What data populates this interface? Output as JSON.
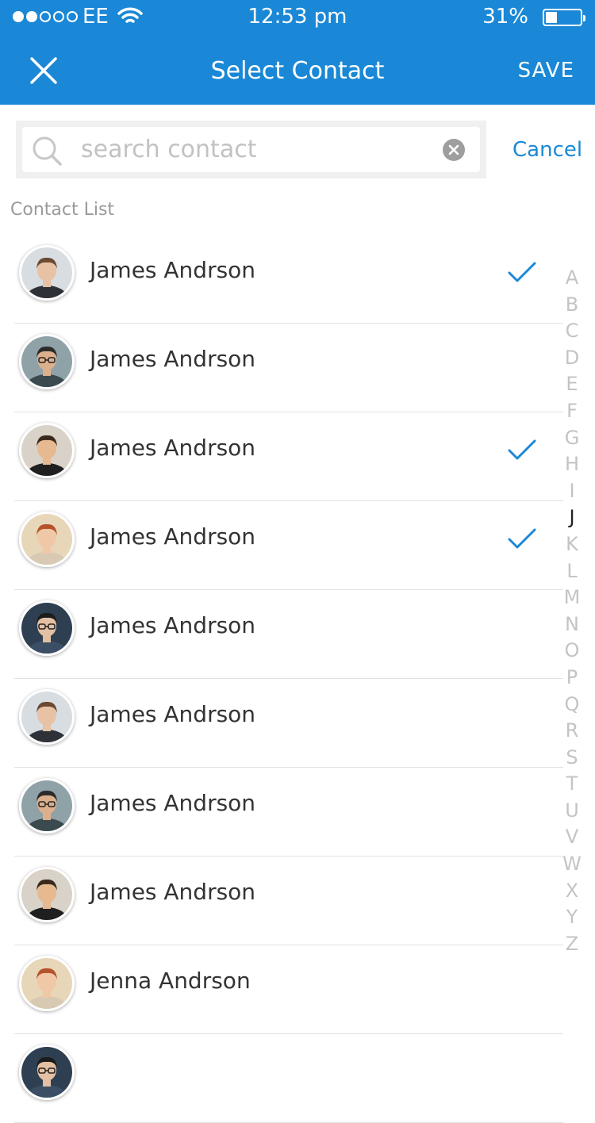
{
  "status_bar": {
    "carrier": "EE",
    "time": "12:53 pm",
    "battery": "31%",
    "battery_level": 0.31
  },
  "nav": {
    "title": "Select Contact",
    "save_label": "SAVE",
    "close_icon": "close-icon"
  },
  "search": {
    "placeholder": "search contact",
    "value": "",
    "cancel_label": "Cancel"
  },
  "section_label": "Contact List",
  "contacts": [
    {
      "name": "James Andrson",
      "selected": true
    },
    {
      "name": "James Andrson",
      "selected": false
    },
    {
      "name": "James Andrson",
      "selected": true
    },
    {
      "name": "James Andrson",
      "selected": true
    },
    {
      "name": "James Andrson",
      "selected": false
    },
    {
      "name": "James Andrson",
      "selected": false
    },
    {
      "name": "James Andrson",
      "selected": false
    },
    {
      "name": "James Andrson",
      "selected": false
    },
    {
      "name": "Jenna Andrson",
      "selected": false
    },
    {
      "name": "",
      "selected": false
    }
  ],
  "alpha_index": [
    "A",
    "B",
    "C",
    "D",
    "E",
    "F",
    "G",
    "H",
    "I",
    "J",
    "K",
    "L",
    "M",
    "N",
    "O",
    "P",
    "Q",
    "R",
    "S",
    "T",
    "U",
    "V",
    "W",
    "X",
    "Y",
    "Z"
  ],
  "alpha_active": "J",
  "colors": {
    "accent": "#1a88d6",
    "header_bg": "#1a88d6",
    "check": "#1a88d6"
  }
}
